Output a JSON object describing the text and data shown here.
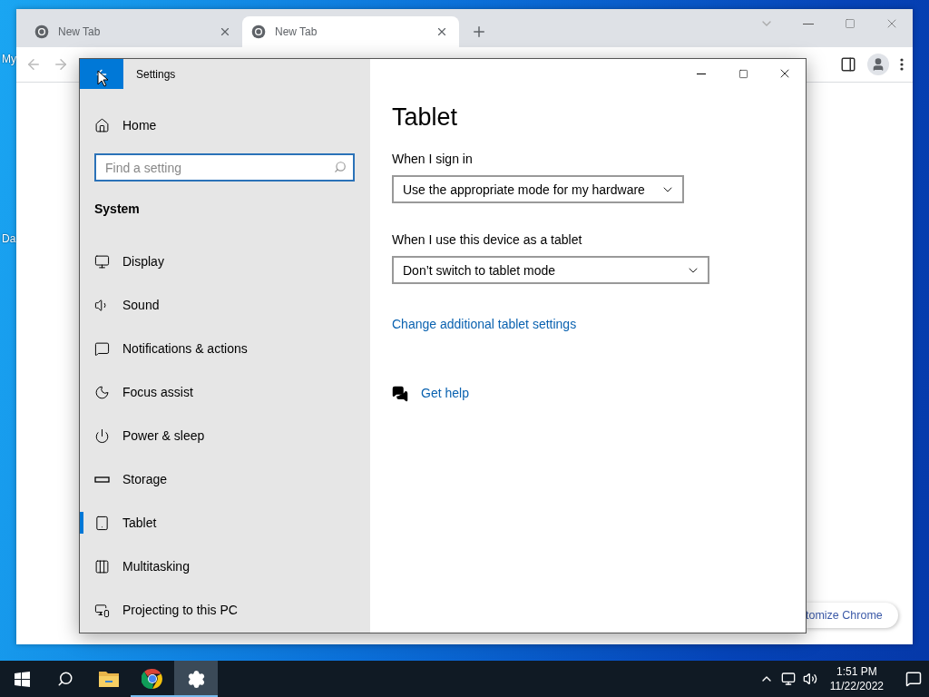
{
  "desktop": {
    "icons": [
      {
        "label": "My"
      },
      {
        "label": "Da"
      }
    ]
  },
  "browser": {
    "tabs": [
      {
        "title": "New Tab",
        "selected": false
      },
      {
        "title": "New Tab",
        "selected": true
      }
    ],
    "customize_button": "tomize Chrome"
  },
  "settings": {
    "title": "Settings",
    "home": "Home",
    "search": {
      "placeholder": "Find a setting"
    },
    "section": "System",
    "items": [
      {
        "label": "Display",
        "kind": "display",
        "selected": false
      },
      {
        "label": "Sound",
        "kind": "sound",
        "selected": false
      },
      {
        "label": "Notifications & actions",
        "kind": "notifications",
        "selected": false
      },
      {
        "label": "Focus assist",
        "kind": "focus",
        "selected": false
      },
      {
        "label": "Power & sleep",
        "kind": "power",
        "selected": false
      },
      {
        "label": "Storage",
        "kind": "storage",
        "selected": false
      },
      {
        "label": "Tablet",
        "kind": "tablet",
        "selected": true
      },
      {
        "label": "Multitasking",
        "kind": "multitasking",
        "selected": false
      },
      {
        "label": "Projecting to this PC",
        "kind": "projecting",
        "selected": false
      }
    ],
    "page": {
      "heading": "Tablet",
      "fields": [
        {
          "label": "When I sign in",
          "value": "Use the appropriate mode for my hardware"
        },
        {
          "label": "When I use this device as a tablet",
          "value": "Don’t switch to tablet mode"
        }
      ],
      "link": "Change additional tablet settings",
      "help": "Get help"
    }
  },
  "taskbar": {
    "apps": [
      {
        "kind": "explorer",
        "running": false,
        "selected": false
      },
      {
        "kind": "chrome",
        "running": true,
        "selected": false
      },
      {
        "kind": "settings",
        "running": true,
        "selected": true
      }
    ],
    "time": "1:51 PM",
    "date": "11/22/2022"
  }
}
